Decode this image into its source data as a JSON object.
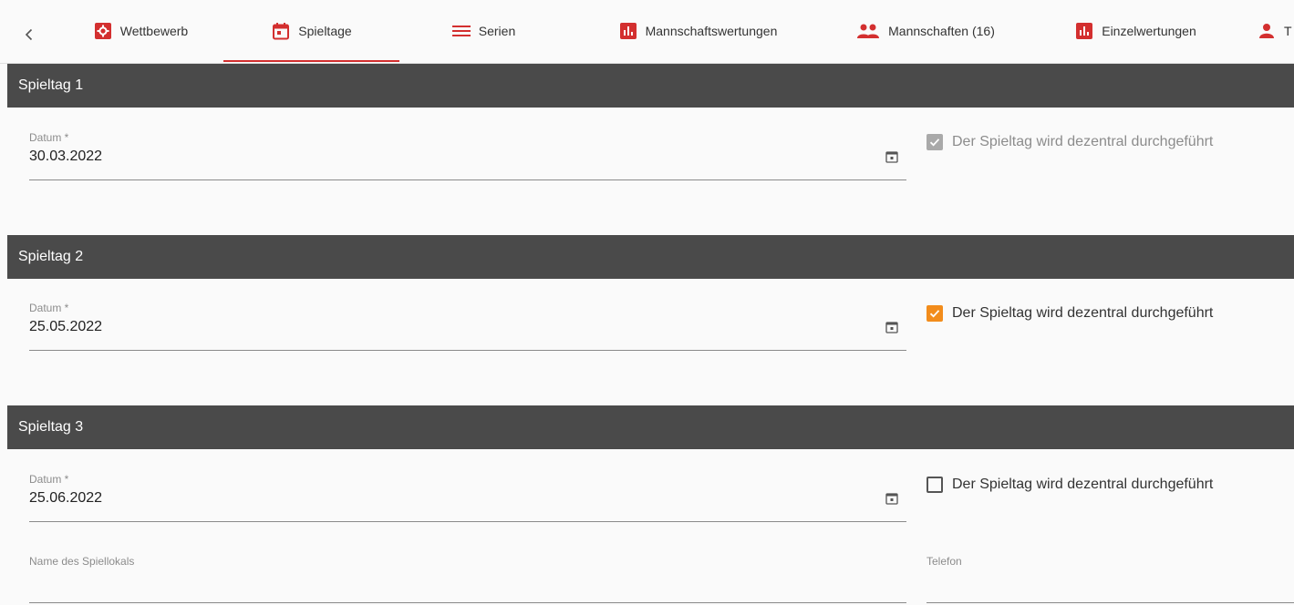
{
  "nav": {
    "back_icon": "chevron-left-icon",
    "tabs": [
      {
        "label": "Wettbewerb",
        "icon": "settings-box-icon",
        "active": false
      },
      {
        "label": "Spieltage",
        "icon": "calendar-icon",
        "active": true
      },
      {
        "label": "Serien",
        "icon": "menu-lines-icon",
        "active": false
      },
      {
        "label": "Mannschaftswertungen",
        "icon": "bar-chart-icon",
        "active": false
      },
      {
        "label": "Mannschaften (16)",
        "icon": "group-icon",
        "active": false
      },
      {
        "label": "Einzelwertungen",
        "icon": "bar-chart-icon",
        "active": false
      },
      {
        "label": "T",
        "icon": "person-icon",
        "active": false
      }
    ]
  },
  "colors": {
    "accent": "#d32f2f",
    "section_header_bg": "#4a4a4a",
    "checkbox_checked": "#f28c1b",
    "checkbox_disabled": "#a9a9a9"
  },
  "spieltage": [
    {
      "title": "Spieltag 1",
      "date_label": "Datum *",
      "date_value": "30.03.2022",
      "decentral_label": "Der Spieltag wird dezentral durchgeführt",
      "decentral_state": "checked-disabled"
    },
    {
      "title": "Spieltag 2",
      "date_label": "Datum *",
      "date_value": "25.05.2022",
      "decentral_label": "Der Spieltag wird dezentral durchgeführt",
      "decentral_state": "checked"
    },
    {
      "title": "Spieltag 3",
      "date_label": "Datum *",
      "date_value": "25.06.2022",
      "decentral_label": "Der Spieltag wird dezentral durchgeführt",
      "decentral_state": "unchecked",
      "venue_label": "Name des Spiellokals",
      "venue_value": "",
      "phone_label": "Telefon",
      "phone_value": ""
    }
  ]
}
